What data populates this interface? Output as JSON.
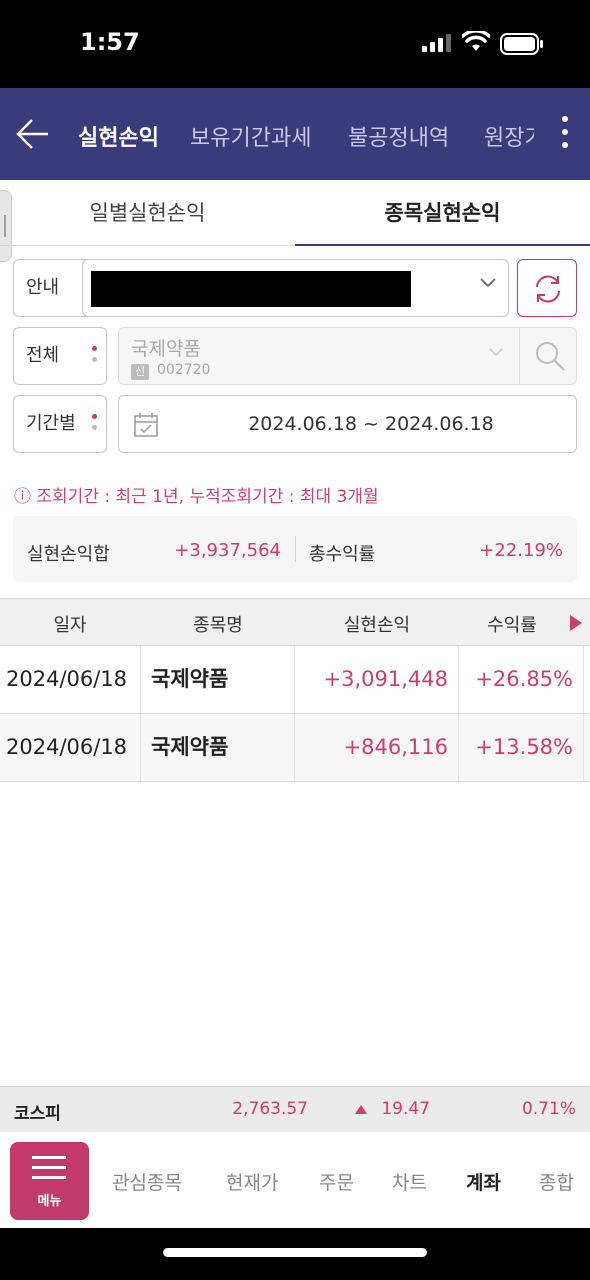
{
  "status_bar": {
    "time": "1:57"
  },
  "header": {
    "tabs": [
      {
        "label": "실현손익"
      },
      {
        "label": "보유기간과세"
      },
      {
        "label": "불공정내역"
      },
      {
        "label": "원장기"
      }
    ]
  },
  "subtabs": [
    {
      "label": "일별실현손익"
    },
    {
      "label": "종목실현손익"
    }
  ],
  "filters": {
    "guide_label": "안내",
    "all_label": "전체",
    "period_label": "기간별",
    "stock_name": "국제약품",
    "stock_badge": "신",
    "stock_code": "002720",
    "date_range": "2024.06.18 ~ 2024.06.18"
  },
  "notice": "ⓘ 조회기간 : 최근 1년, 누적조회기간 : 최대 3개월",
  "summary": {
    "realized_label": "실현손익합",
    "realized_value": "+3,937,564",
    "return_label": "총수익률",
    "return_value": "+22.19%"
  },
  "table": {
    "headers": [
      "일자",
      "종목명",
      "실현손익",
      "수익률"
    ],
    "rows": [
      [
        "2024/06/18",
        "국제약품",
        "+3,091,448",
        "+26.85%"
      ],
      [
        "2024/06/18",
        "국제약품",
        "+846,116",
        "+13.58%"
      ]
    ]
  },
  "ticker": {
    "name": "코스피",
    "value": "2,763.57",
    "change": "19.47",
    "percent": "0.71%"
  },
  "bottom_nav": {
    "menu_label": "메뉴",
    "items": [
      "관심종목",
      "현재가",
      "주문",
      "차트",
      "계좌",
      "종합"
    ]
  },
  "colors": {
    "header_bg": "#3a3b7a",
    "accent_red": "#d43b6d",
    "menu_bg": "#c23a6a"
  }
}
